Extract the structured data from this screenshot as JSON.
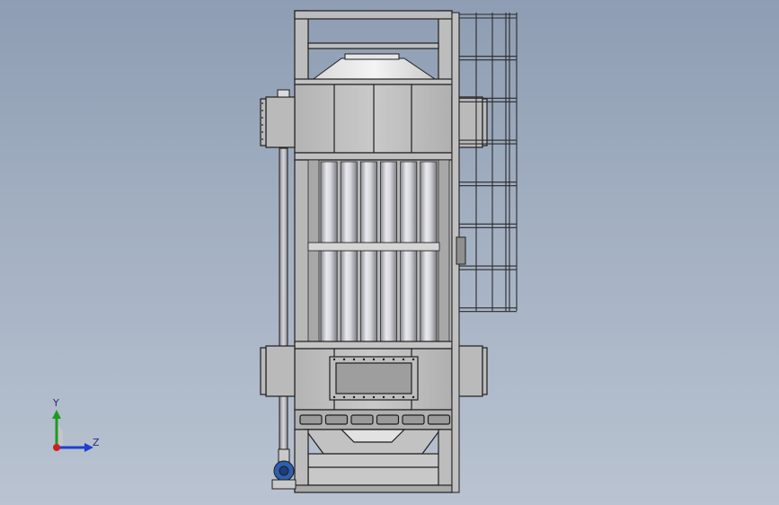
{
  "viewport": {
    "background_top": "#8e9db3",
    "background_bottom": "#b9c3d1"
  },
  "model": {
    "body_color": "#bfbfbf",
    "edge_color": "#1e1e1e",
    "tube_count": 6,
    "ladder_rungs": 8
  },
  "triad": {
    "y_label": "Y",
    "z_label": "Z",
    "y_color": "#1f9a1f",
    "z_color": "#1f3fd0",
    "x_color": "#d01f1f"
  },
  "pump": {
    "color": "#2d5fb0"
  }
}
